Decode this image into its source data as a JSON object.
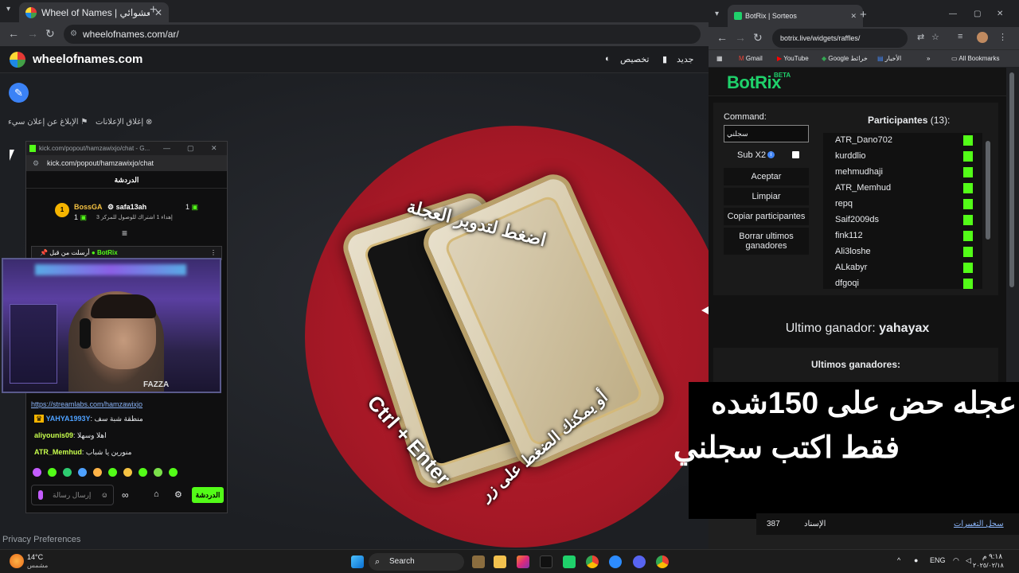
{
  "main_browser": {
    "tab_title": "Wheel of Names | عجلة الاسم العشوائي",
    "url": "wheelofnames.com/ar/"
  },
  "wheelofnames": {
    "brand": "wheelofnames.com",
    "menu": {
      "customize": "تخصيص",
      "new": "جديد"
    },
    "report_ad": "الإبلاغ عن إعلان سيء",
    "close_ads": "إغلاق الإعلانات",
    "wheel_text_top": "اضغط لتدوير العجلة",
    "wheel_text_middle": "أو يمكنك الضغط على زر",
    "wheel_text_shortcut": "Ctrl + Enter",
    "privacy": "Privacy Preferences"
  },
  "chat_popout": {
    "window_title": "kick.com/popout/hamzawixjo/chat - G...",
    "url": "kick.com/popout/hamzawixjo/chat",
    "header": "الدردشة",
    "leader_1_name": "BossGA",
    "leader_1_count": "1",
    "leader_2_name": "safa13ah",
    "leader_2_count": "1",
    "leader_2_sub": "إهداء 1 اشتراك للوصول للمركز 3",
    "pinned_by": "BotRix",
    "pinned_label": "أرسلت من قبل",
    "messages": [
      {
        "user": "",
        "text": "https://streamlabs.com/hamzawixjo"
      },
      {
        "user": "YAHYA1993Y",
        "text": "منطقة شبة سف"
      },
      {
        "user": "aliyounis09",
        "text": "اهلا وسهلا"
      },
      {
        "user": "ATR_Memhud",
        "text": "منورين يا شباب"
      }
    ],
    "input_placeholder": "إرسال رسالة",
    "send_label": "الدردشة",
    "webcam_brand": "FAZZA"
  },
  "botrix_browser": {
    "tab_title": "BotRix | Sorteos",
    "url": "botrix.live/widgets/raffles/",
    "bookmarks": [
      "Gmail",
      "YouTube",
      "Google خرائط",
      "الأخبار",
      "All Bookmarks"
    ]
  },
  "botrix": {
    "logo": "BotRix",
    "beta": "BETA",
    "command_label": "Command:",
    "command_value": "سجلني",
    "sub_x2": "Sub X2",
    "buttons": {
      "accept": "Aceptar",
      "clear": "Limpiar",
      "copy": "Copiar participantes",
      "clear_winners": "Borrar ultimos ganadores"
    },
    "participants_title": "Participantes",
    "participants_count": "(13):",
    "participants": [
      "ATR_Dano702",
      "kurddlio",
      "mehmudhaji",
      "ATR_Memhud",
      "repq",
      "Saif2009ds",
      "fink112",
      "Ali3loshe",
      "ALkabyr",
      "dfgoqi"
    ],
    "last_winner_label": "Ultimo ganador:",
    "last_winner": "yahayax",
    "last_winners_title": "Ultimos ganadores:"
  },
  "overlay": {
    "line1": "عجله حض على 150شده",
    "line2": "فقط اكتب سجلني"
  },
  "under_bar": {
    "count": "387",
    "label": "الإسناد",
    "link": "سجل التغييرات"
  },
  "taskbar": {
    "weather_temp": "14°C",
    "weather_desc": "مشمس",
    "search": "Search",
    "lang": "ENG",
    "time": "٩:١٨ م",
    "date": "٢٠٢٥/٠٢/١٨"
  }
}
